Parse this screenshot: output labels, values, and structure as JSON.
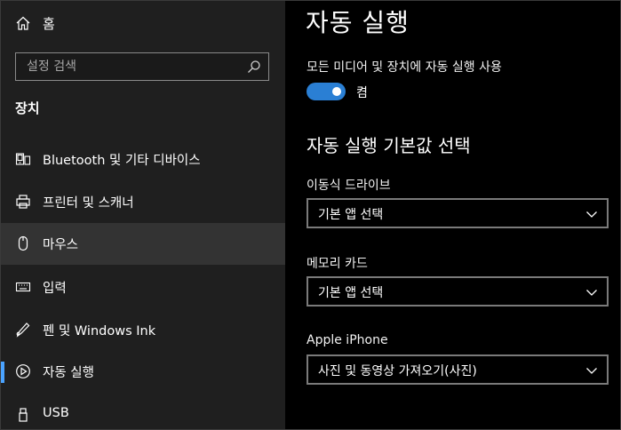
{
  "sidebar": {
    "home_label": "홈",
    "search": {
      "placeholder": "설정 검색",
      "value": ""
    },
    "section_title": "장치",
    "items": [
      {
        "label": "Bluetooth 및 기타 디바이스",
        "icon": "bluetooth-device-icon"
      },
      {
        "label": "프린터 및 스캐너",
        "icon": "printer-icon"
      },
      {
        "label": "마우스",
        "icon": "mouse-icon"
      },
      {
        "label": "입력",
        "icon": "keyboard-icon"
      },
      {
        "label": "펜 및 Windows Ink",
        "icon": "pen-icon"
      },
      {
        "label": "자동 실행",
        "icon": "autoplay-icon",
        "selected": true
      },
      {
        "label": "USB",
        "icon": "usb-icon"
      }
    ],
    "hovered_item": "마우스"
  },
  "main": {
    "title": "자동 실행",
    "autoplay_toggle": {
      "caption": "모든 미디어 및 장치에 자동 실행 사용",
      "state_label": "켬",
      "on": true
    },
    "defaults_heading": "자동 실행 기본값 선택",
    "fields": [
      {
        "label": "이동식 드라이브",
        "selected": "기본 앱 선택"
      },
      {
        "label": "메모리 카드",
        "selected": "기본 앱 선택"
      },
      {
        "label": "Apple iPhone",
        "selected": "사진 및 동영상 가져오기(사진)"
      }
    ]
  },
  "colors": {
    "accent": "#4aa3ff",
    "toggle_on": "#2a7fd4",
    "sidebar_bg": "#1f1f1f",
    "hover_bg": "#333333",
    "main_bg": "#000000"
  }
}
